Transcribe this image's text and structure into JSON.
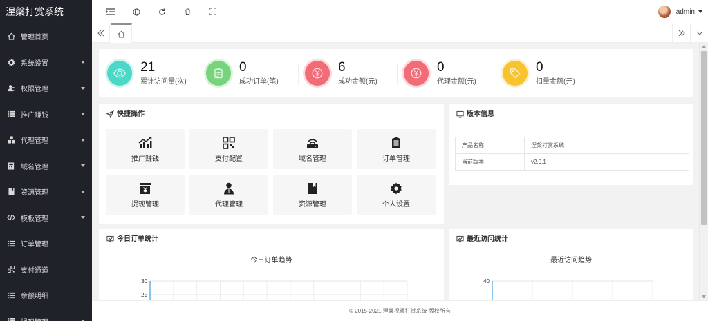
{
  "app": {
    "title": "涅槃打赏系统"
  },
  "sidebar": {
    "items": [
      {
        "label": "管理首页",
        "icon": "home-icon",
        "has_children": false
      },
      {
        "label": "系统设置",
        "icon": "gear-icon",
        "has_children": true
      },
      {
        "label": "权限管理",
        "icon": "users-icon",
        "has_children": true
      },
      {
        "label": "推广赚钱",
        "icon": "list-icon",
        "has_children": true
      },
      {
        "label": "代理管理",
        "icon": "cubes-icon",
        "has_children": true
      },
      {
        "label": "域名管理",
        "icon": "calculator-icon",
        "has_children": true
      },
      {
        "label": "资源管理",
        "icon": "bookmark-icon",
        "has_children": true
      },
      {
        "label": "模板管理",
        "icon": "code-icon",
        "has_children": true
      },
      {
        "label": "订单管理",
        "icon": "list-icon",
        "has_children": false
      },
      {
        "label": "支付通道",
        "icon": "qrcode-icon",
        "has_children": false
      },
      {
        "label": "余额明细",
        "icon": "list-icon",
        "has_children": false
      },
      {
        "label": "提现管理",
        "icon": "list-icon",
        "has_children": true
      }
    ]
  },
  "header": {
    "icons": [
      "shrink-menu-icon",
      "globe-icon",
      "refresh-icon",
      "trash-icon",
      "fullscreen-icon"
    ],
    "user": "admin"
  },
  "stats": [
    {
      "value": "21",
      "label": "累计访问量(次)",
      "color": "#4dd9c6",
      "icon": "eye-icon"
    },
    {
      "value": "0",
      "label": "成功订单(笔)",
      "color": "#79d47d",
      "icon": "clipboard-icon"
    },
    {
      "value": "6",
      "label": "成功金额(元)",
      "color": "#f26c78",
      "icon": "yen-icon"
    },
    {
      "value": "0",
      "label": "代理金额(元)",
      "color": "#f26c78",
      "icon": "yen-icon"
    },
    {
      "value": "0",
      "label": "扣量金额(元)",
      "color": "#f7c531",
      "icon": "tag-icon"
    }
  ],
  "quick_ops": {
    "title": "快捷操作",
    "items": [
      {
        "label": "推广赚钱",
        "icon": "growth-chart-icon"
      },
      {
        "label": "支付配置",
        "icon": "qrcode-icon"
      },
      {
        "label": "域名管理",
        "icon": "router-icon"
      },
      {
        "label": "订单管理",
        "icon": "list-box-icon"
      },
      {
        "label": "提现管理",
        "icon": "yen-box-icon"
      },
      {
        "label": "代理管理",
        "icon": "person-icon"
      },
      {
        "label": "资源管理",
        "icon": "bookmark-icon"
      },
      {
        "label": "个人设置",
        "icon": "gear-icon"
      }
    ]
  },
  "version_info": {
    "title": "版本信息",
    "rows": [
      {
        "key": "产品名称",
        "value": "涅槃打赏系统"
      },
      {
        "key": "当前版本",
        "value": "v2.0.1"
      }
    ]
  },
  "orders_panel": {
    "title": "今日订单统计",
    "chart_title": "今日订单趋势"
  },
  "visits_panel": {
    "title": "最近访问统计",
    "chart_title": "最近访问趋势"
  },
  "chart_data": [
    {
      "type": "line",
      "title": "今日订单趋势",
      "y_ticks_visible": [
        30,
        25
      ],
      "ylim": [
        0,
        30
      ],
      "grid": true,
      "color": "#3aa0e6"
    },
    {
      "type": "line",
      "title": "最近访问趋势",
      "y_ticks_visible": [
        40
      ],
      "ylim": [
        0,
        40
      ],
      "grid": true,
      "color": "#3aa0e6"
    }
  ],
  "footer": {
    "text": "© 2015-2021 涅槃视频打赏系统 版权所有"
  }
}
